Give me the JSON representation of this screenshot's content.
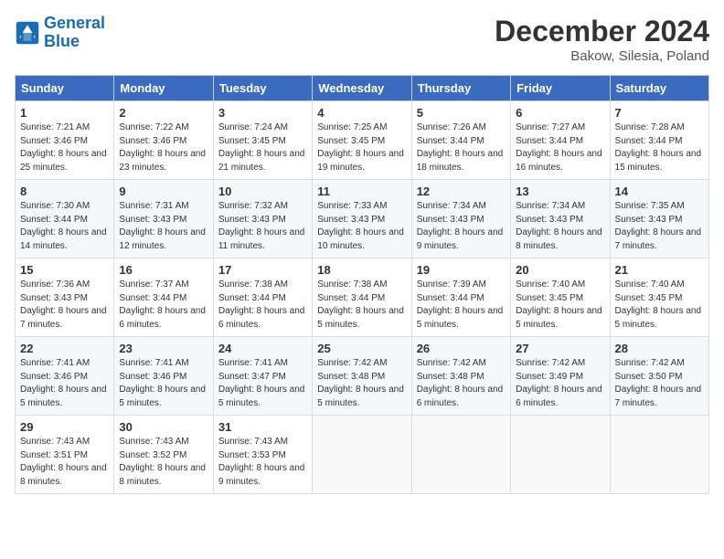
{
  "header": {
    "logo_line1": "General",
    "logo_line2": "Blue",
    "month": "December 2024",
    "location": "Bakow, Silesia, Poland"
  },
  "weekdays": [
    "Sunday",
    "Monday",
    "Tuesday",
    "Wednesday",
    "Thursday",
    "Friday",
    "Saturday"
  ],
  "weeks": [
    [
      {
        "day": "1",
        "sunrise": "Sunrise: 7:21 AM",
        "sunset": "Sunset: 3:46 PM",
        "daylight": "Daylight: 8 hours and 25 minutes."
      },
      {
        "day": "2",
        "sunrise": "Sunrise: 7:22 AM",
        "sunset": "Sunset: 3:46 PM",
        "daylight": "Daylight: 8 hours and 23 minutes."
      },
      {
        "day": "3",
        "sunrise": "Sunrise: 7:24 AM",
        "sunset": "Sunset: 3:45 PM",
        "daylight": "Daylight: 8 hours and 21 minutes."
      },
      {
        "day": "4",
        "sunrise": "Sunrise: 7:25 AM",
        "sunset": "Sunset: 3:45 PM",
        "daylight": "Daylight: 8 hours and 19 minutes."
      },
      {
        "day": "5",
        "sunrise": "Sunrise: 7:26 AM",
        "sunset": "Sunset: 3:44 PM",
        "daylight": "Daylight: 8 hours and 18 minutes."
      },
      {
        "day": "6",
        "sunrise": "Sunrise: 7:27 AM",
        "sunset": "Sunset: 3:44 PM",
        "daylight": "Daylight: 8 hours and 16 minutes."
      },
      {
        "day": "7",
        "sunrise": "Sunrise: 7:28 AM",
        "sunset": "Sunset: 3:44 PM",
        "daylight": "Daylight: 8 hours and 15 minutes."
      }
    ],
    [
      {
        "day": "8",
        "sunrise": "Sunrise: 7:30 AM",
        "sunset": "Sunset: 3:44 PM",
        "daylight": "Daylight: 8 hours and 14 minutes."
      },
      {
        "day": "9",
        "sunrise": "Sunrise: 7:31 AM",
        "sunset": "Sunset: 3:43 PM",
        "daylight": "Daylight: 8 hours and 12 minutes."
      },
      {
        "day": "10",
        "sunrise": "Sunrise: 7:32 AM",
        "sunset": "Sunset: 3:43 PM",
        "daylight": "Daylight: 8 hours and 11 minutes."
      },
      {
        "day": "11",
        "sunrise": "Sunrise: 7:33 AM",
        "sunset": "Sunset: 3:43 PM",
        "daylight": "Daylight: 8 hours and 10 minutes."
      },
      {
        "day": "12",
        "sunrise": "Sunrise: 7:34 AM",
        "sunset": "Sunset: 3:43 PM",
        "daylight": "Daylight: 8 hours and 9 minutes."
      },
      {
        "day": "13",
        "sunrise": "Sunrise: 7:34 AM",
        "sunset": "Sunset: 3:43 PM",
        "daylight": "Daylight: 8 hours and 8 minutes."
      },
      {
        "day": "14",
        "sunrise": "Sunrise: 7:35 AM",
        "sunset": "Sunset: 3:43 PM",
        "daylight": "Daylight: 8 hours and 7 minutes."
      }
    ],
    [
      {
        "day": "15",
        "sunrise": "Sunrise: 7:36 AM",
        "sunset": "Sunset: 3:43 PM",
        "daylight": "Daylight: 8 hours and 7 minutes."
      },
      {
        "day": "16",
        "sunrise": "Sunrise: 7:37 AM",
        "sunset": "Sunset: 3:44 PM",
        "daylight": "Daylight: 8 hours and 6 minutes."
      },
      {
        "day": "17",
        "sunrise": "Sunrise: 7:38 AM",
        "sunset": "Sunset: 3:44 PM",
        "daylight": "Daylight: 8 hours and 6 minutes."
      },
      {
        "day": "18",
        "sunrise": "Sunrise: 7:38 AM",
        "sunset": "Sunset: 3:44 PM",
        "daylight": "Daylight: 8 hours and 5 minutes."
      },
      {
        "day": "19",
        "sunrise": "Sunrise: 7:39 AM",
        "sunset": "Sunset: 3:44 PM",
        "daylight": "Daylight: 8 hours and 5 minutes."
      },
      {
        "day": "20",
        "sunrise": "Sunrise: 7:40 AM",
        "sunset": "Sunset: 3:45 PM",
        "daylight": "Daylight: 8 hours and 5 minutes."
      },
      {
        "day": "21",
        "sunrise": "Sunrise: 7:40 AM",
        "sunset": "Sunset: 3:45 PM",
        "daylight": "Daylight: 8 hours and 5 minutes."
      }
    ],
    [
      {
        "day": "22",
        "sunrise": "Sunrise: 7:41 AM",
        "sunset": "Sunset: 3:46 PM",
        "daylight": "Daylight: 8 hours and 5 minutes."
      },
      {
        "day": "23",
        "sunrise": "Sunrise: 7:41 AM",
        "sunset": "Sunset: 3:46 PM",
        "daylight": "Daylight: 8 hours and 5 minutes."
      },
      {
        "day": "24",
        "sunrise": "Sunrise: 7:41 AM",
        "sunset": "Sunset: 3:47 PM",
        "daylight": "Daylight: 8 hours and 5 minutes."
      },
      {
        "day": "25",
        "sunrise": "Sunrise: 7:42 AM",
        "sunset": "Sunset: 3:48 PM",
        "daylight": "Daylight: 8 hours and 5 minutes."
      },
      {
        "day": "26",
        "sunrise": "Sunrise: 7:42 AM",
        "sunset": "Sunset: 3:48 PM",
        "daylight": "Daylight: 8 hours and 6 minutes."
      },
      {
        "day": "27",
        "sunrise": "Sunrise: 7:42 AM",
        "sunset": "Sunset: 3:49 PM",
        "daylight": "Daylight: 8 hours and 6 minutes."
      },
      {
        "day": "28",
        "sunrise": "Sunrise: 7:42 AM",
        "sunset": "Sunset: 3:50 PM",
        "daylight": "Daylight: 8 hours and 7 minutes."
      }
    ],
    [
      {
        "day": "29",
        "sunrise": "Sunrise: 7:43 AM",
        "sunset": "Sunset: 3:51 PM",
        "daylight": "Daylight: 8 hours and 8 minutes."
      },
      {
        "day": "30",
        "sunrise": "Sunrise: 7:43 AM",
        "sunset": "Sunset: 3:52 PM",
        "daylight": "Daylight: 8 hours and 8 minutes."
      },
      {
        "day": "31",
        "sunrise": "Sunrise: 7:43 AM",
        "sunset": "Sunset: 3:53 PM",
        "daylight": "Daylight: 8 hours and 9 minutes."
      },
      null,
      null,
      null,
      null
    ]
  ]
}
